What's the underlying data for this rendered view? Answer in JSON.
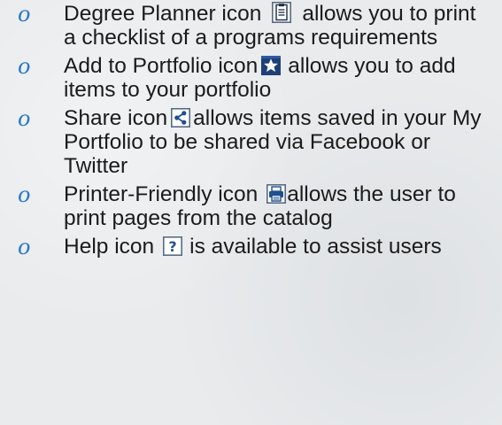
{
  "bullets": [
    {
      "before": "Degree Planner icon",
      "icon": "degree-planner-icon",
      "after": "allows you to print a checklist of a programs requirements"
    },
    {
      "before": "Add to Portfolio icon",
      "icon": "add-to-portfolio-star-icon",
      "after": "allows you to add items to your portfolio"
    },
    {
      "before": "Share icon",
      "icon": "share-icon",
      "after": "allows items saved in your My Portfolio to be shared via Facebook or Twitter"
    },
    {
      "before": "Printer-Friendly icon",
      "icon": "printer-friendly-icon",
      "after": "allows the user to print pages from the catalog"
    },
    {
      "before": "Help icon",
      "icon": "help-question-icon",
      "after": "is available to assist users"
    }
  ],
  "colors": {
    "text": "#1b1b1b",
    "marker": "#2a78c8",
    "icon_blue": "#1f4f8f",
    "icon_frame": "#5a6b82"
  }
}
